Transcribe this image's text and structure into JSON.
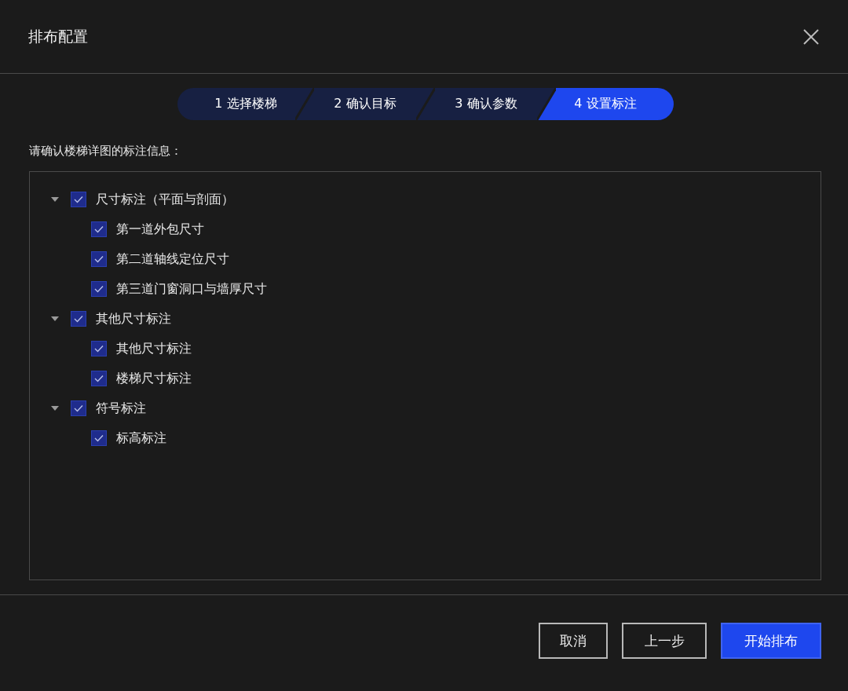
{
  "window": {
    "title": "排布配置"
  },
  "steps": [
    {
      "label": "1 选择楼梯",
      "selected": false
    },
    {
      "label": "2 确认目标",
      "selected": false
    },
    {
      "label": "3 确认参数",
      "selected": false
    },
    {
      "label": "4 设置标注",
      "selected": true
    }
  ],
  "prompt": "请确认楼梯详图的标注信息：",
  "tree": [
    {
      "label": "尺寸标注（平面与剖面）",
      "checked": true,
      "expanded": true,
      "children": [
        {
          "label": "第一道外包尺寸",
          "checked": true
        },
        {
          "label": "第二道轴线定位尺寸",
          "checked": true
        },
        {
          "label": "第三道门窗洞口与墙厚尺寸",
          "checked": true
        }
      ]
    },
    {
      "label": "其他尺寸标注",
      "checked": true,
      "expanded": true,
      "children": [
        {
          "label": "其他尺寸标注",
          "checked": true
        },
        {
          "label": "楼梯尺寸标注",
          "checked": true
        }
      ]
    },
    {
      "label": "符号标注",
      "checked": true,
      "expanded": true,
      "children": [
        {
          "label": "标高标注",
          "checked": true
        }
      ]
    }
  ],
  "buttons": [
    {
      "label": "取消",
      "kind": "secondary"
    },
    {
      "label": "上一步",
      "kind": "secondary"
    },
    {
      "label": "开始排布",
      "kind": "primary"
    }
  ]
}
